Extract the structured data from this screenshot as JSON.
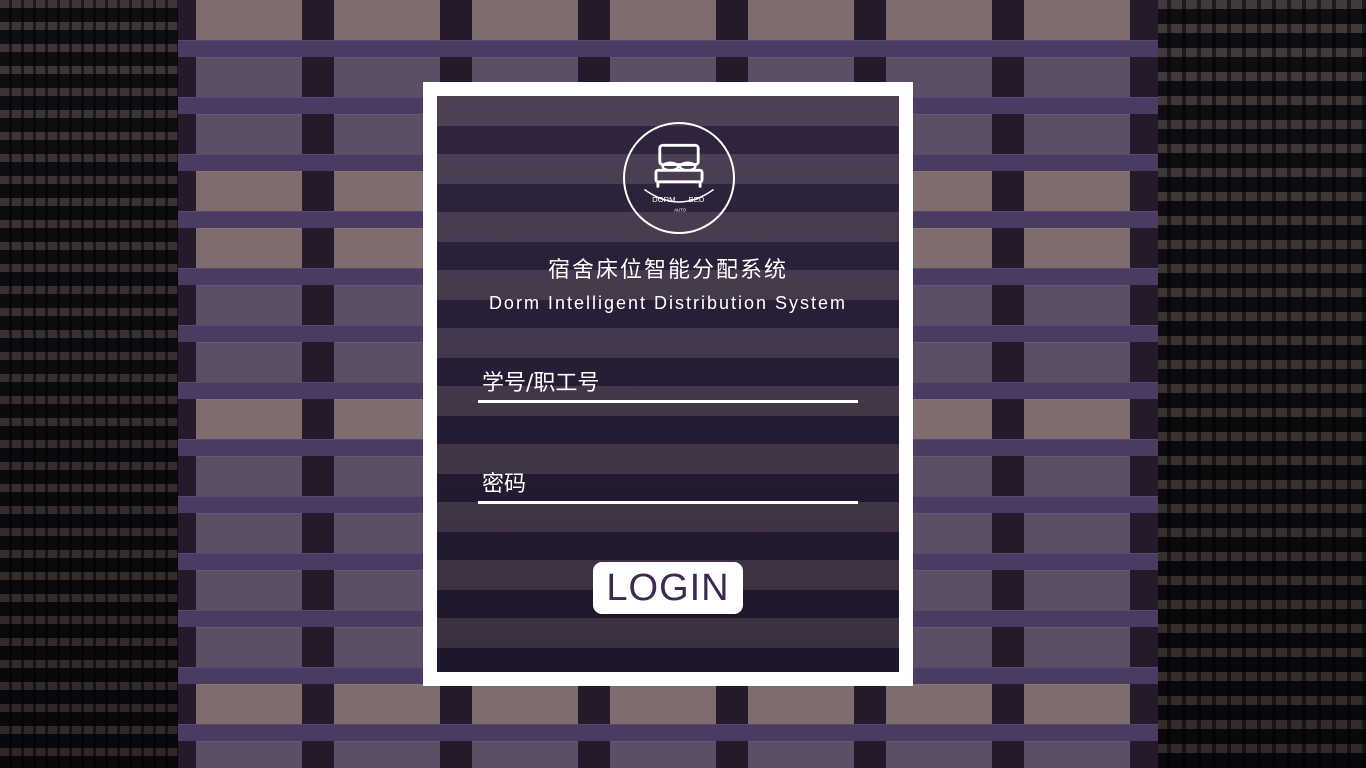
{
  "logo": {
    "icon": "bed-icon",
    "text_left": "DORM",
    "text_right": "BED",
    "text_bottom": "AUTO"
  },
  "title": {
    "cn": "宿舍床位智能分配系统",
    "en": "Dorm Intelligent Distribution System"
  },
  "form": {
    "username_placeholder": "学号/职工号",
    "password_placeholder": "密码",
    "username_value": "",
    "password_value": ""
  },
  "login_button": {
    "label": "LOGIN"
  },
  "colors": {
    "panel_border": "#ffffff",
    "text": "#ffffff",
    "button_bg": "#ffffff",
    "button_text": "#3d2a4f"
  }
}
